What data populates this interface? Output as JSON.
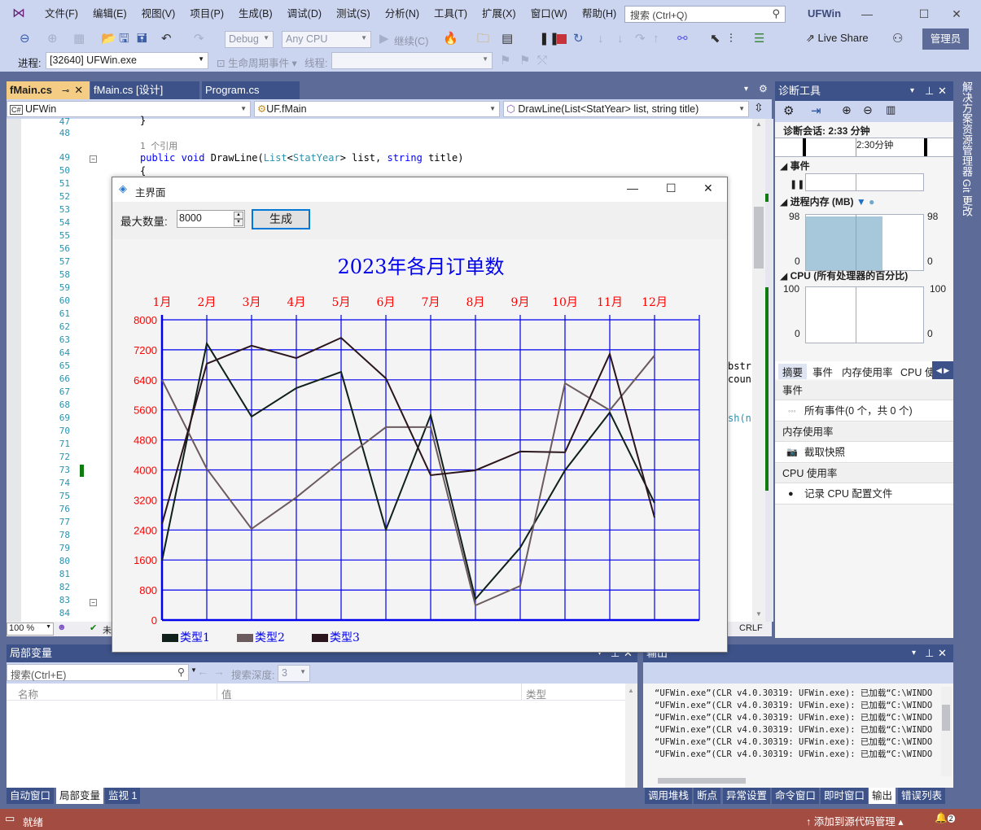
{
  "menubar": {
    "items": [
      "文件(F)",
      "编辑(E)",
      "视图(V)",
      "项目(P)",
      "生成(B)",
      "调试(D)",
      "测试(S)",
      "分析(N)",
      "工具(T)",
      "扩展(X)",
      "窗口(W)",
      "帮助(H)"
    ],
    "search_placeholder": "搜索 (Ctrl+Q)",
    "app_title": "UFWin",
    "admin_label": "管理员"
  },
  "toolbar": {
    "config": "Debug",
    "platform": "Any CPU",
    "continue_label": "继续(C)",
    "live_share": "Live Share",
    "process_label": "进程:",
    "process_value": "[32640] UFWin.exe",
    "lifecycle_label": "生命周期事件",
    "thread_label": "线程:"
  },
  "editor": {
    "tabs": [
      {
        "label": "fMain.cs",
        "active": true
      },
      {
        "label": "fMain.cs [设计]",
        "active": false
      },
      {
        "label": "Program.cs",
        "active": false
      }
    ],
    "nav": {
      "project": "UFWin",
      "class": "UF.fMain",
      "member": "DrawLine(List<StatYear> list, string title)"
    },
    "line_numbers": [
      "47",
      "48",
      "49",
      "50",
      "51",
      "52",
      "53",
      "54",
      "55",
      "56",
      "57",
      "58",
      "59",
      "60",
      "61",
      "62",
      "63",
      "64",
      "65",
      "66",
      "67",
      "68",
      "69",
      "70",
      "71",
      "72",
      "73",
      "74",
      "75",
      "76",
      "77",
      "78",
      "79",
      "80",
      "81",
      "82",
      "83",
      "84"
    ],
    "ref_hint": "1 个引用",
    "code_line_47": "}",
    "code_sig": {
      "kw1": "public",
      "kw2": "void",
      "name": " DrawLine(",
      "type1": "List",
      "lt": "<",
      "type2": "StatYear",
      "rest1": "> list, ",
      "kw3": "string",
      "rest2": " title)"
    },
    "code_line_50": "{",
    "right_fragments": [
      "bstr",
      "coun",
      "sh(n"
    ],
    "zoom": "100 %",
    "status_partial": "未",
    "line_ending": "CRLF"
  },
  "form": {
    "title": "主界面",
    "max_label": "最大数量:",
    "max_value": "8000",
    "generate_label": "生成"
  },
  "chart_data": {
    "type": "line",
    "title": "2023年各月订单数",
    "categories": [
      "1月",
      "2月",
      "3月",
      "4月",
      "5月",
      "6月",
      "7月",
      "8月",
      "9月",
      "10月",
      "11月",
      "12月"
    ],
    "yticks": [
      "0",
      "800",
      "1600",
      "2400",
      "3200",
      "4000",
      "4800",
      "5600",
      "6400",
      "7200",
      "8000"
    ],
    "ylim": [
      0,
      8000
    ],
    "grid": true,
    "legend_position": "bottom-left",
    "series": [
      {
        "name": "类型1",
        "color": "#10201a",
        "values": [
          1580,
          7370,
          5420,
          6180,
          6610,
          2410,
          5460,
          560,
          1930,
          3990,
          5530,
          3120
        ]
      },
      {
        "name": "类型2",
        "color": "#6b5a5e",
        "values": [
          6400,
          4030,
          2430,
          3270,
          4230,
          5140,
          5140,
          390,
          910,
          6310,
          5590,
          7050
        ]
      },
      {
        "name": "类型3",
        "color": "#2a161c",
        "values": [
          2560,
          6830,
          7310,
          6980,
          7520,
          6440,
          3860,
          3990,
          4490,
          4470,
          7090,
          2730
        ]
      }
    ],
    "colors": {
      "grid": "#0000ee",
      "tick_text": "#ff0000",
      "title": "#0000ee",
      "legend_text": "#0000ee"
    }
  },
  "diagnostics": {
    "title": "诊断工具",
    "session": "诊断会话: 2:33 分钟",
    "timeline_label": "2:30分钟",
    "events_label": "事件",
    "memory_label": "进程内存 (MB)",
    "memory_max": "98",
    "memory_min": "0",
    "memory_fill": 0.97,
    "cpu_label": "CPU (所有处理器的百分比)",
    "cpu_max": "100",
    "cpu_min": "0",
    "tabs": [
      "摘要",
      "事件",
      "内存使用率",
      "CPU 使"
    ],
    "sections": [
      {
        "header": "事件",
        "item": "所有事件(0 个，共 0 个)"
      },
      {
        "header": "内存使用率",
        "item": "截取快照"
      },
      {
        "header": "CPU 使用率",
        "item": "记录 CPU 配置文件"
      }
    ]
  },
  "side_strip": [
    "解决方案资源管理器",
    "Git 更改"
  ],
  "locals": {
    "title": "局部变量",
    "search_placeholder": "搜索(Ctrl+E)",
    "depth_label": "搜索深度:",
    "depth_value": "3",
    "columns": [
      "名称",
      "值",
      "类型"
    ],
    "tabs": [
      {
        "label": "自动窗口",
        "active": false
      },
      {
        "label": "局部变量",
        "active": true
      },
      {
        "label": "监视 1",
        "active": false
      }
    ]
  },
  "output": {
    "title": "输出",
    "lines": [
      "“UFWin.exe”(CLR v4.0.30319: UFWin.exe): 已加载“C:\\WINDO",
      "“UFWin.exe”(CLR v4.0.30319: UFWin.exe): 已加载“C:\\WINDO",
      "“UFWin.exe”(CLR v4.0.30319: UFWin.exe): 已加载“C:\\WINDO",
      "“UFWin.exe”(CLR v4.0.30319: UFWin.exe): 已加载“C:\\WINDO",
      "“UFWin.exe”(CLR v4.0.30319: UFWin.exe): 已加载“C:\\WINDO",
      "“UFWin.exe”(CLR v4.0.30319: UFWin.exe): 已加载“C:\\WINDO"
    ],
    "tabs": [
      {
        "label": "调用堆栈",
        "active": false
      },
      {
        "label": "断点",
        "active": false
      },
      {
        "label": "异常设置",
        "active": false
      },
      {
        "label": "命令窗口",
        "active": false
      },
      {
        "label": "即时窗口",
        "active": false
      },
      {
        "label": "输出",
        "active": true
      },
      {
        "label": "错误列表",
        "active": false
      }
    ]
  },
  "statusbar": {
    "ready": "就绪",
    "source_control": "添加到源代码管理",
    "notifications": "2"
  }
}
